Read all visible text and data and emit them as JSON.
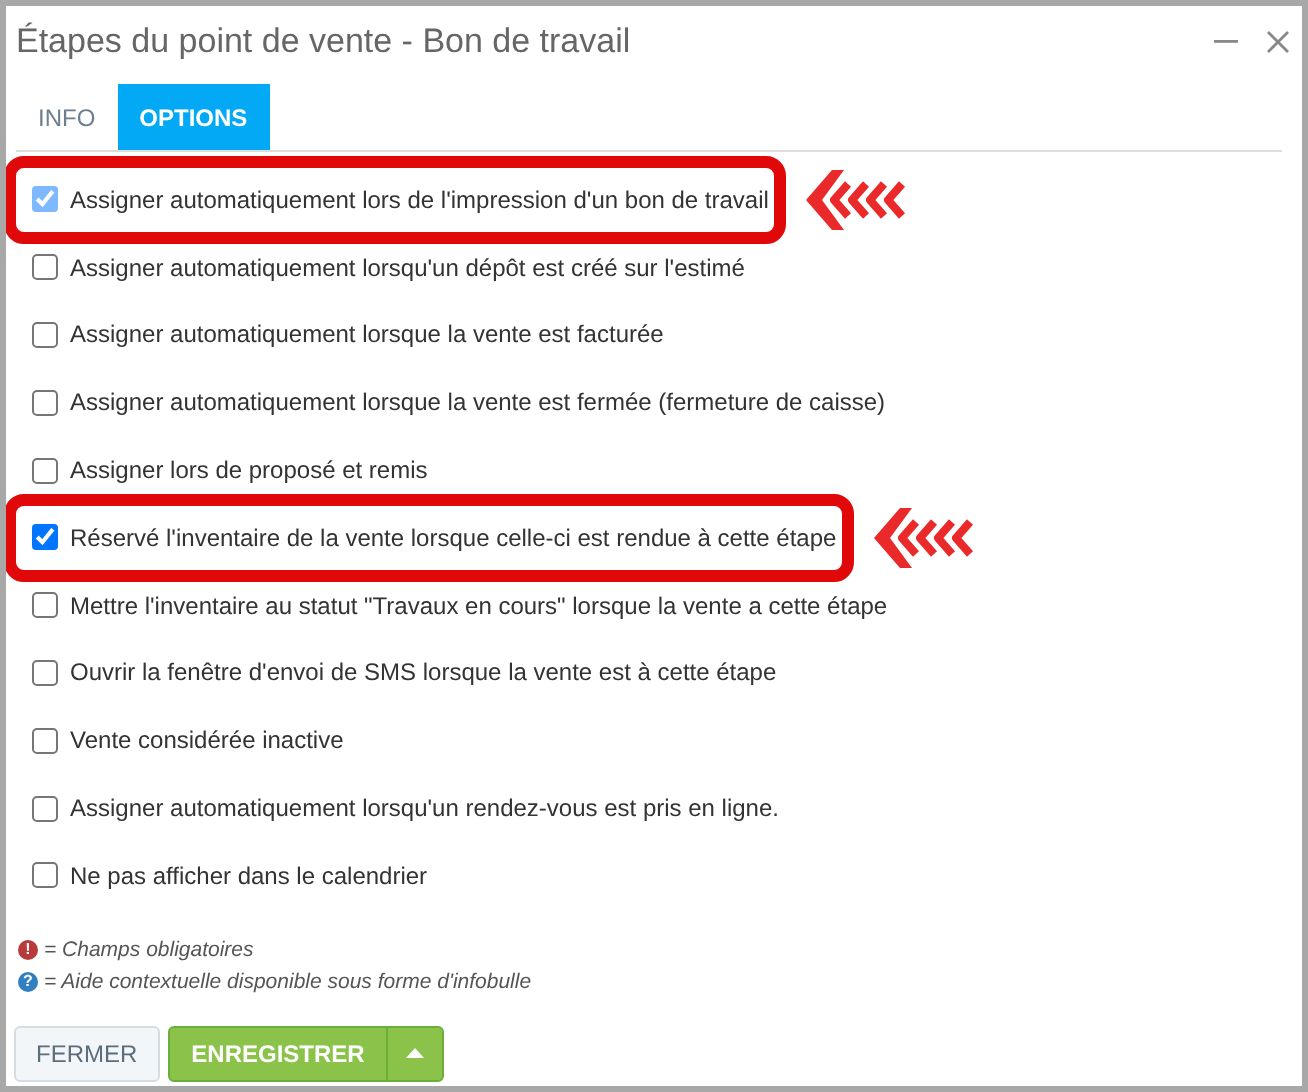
{
  "window": {
    "title": "Étapes du point de vente - Bon de travail"
  },
  "tabs": [
    {
      "label": "INFO",
      "selected": false
    },
    {
      "label": "OPTIONS",
      "selected": true
    }
  ],
  "options": [
    {
      "label": "Assigner automatiquement lors de l'impression d'un bon de travail",
      "checked": true,
      "disabled": true,
      "highlighted": true
    },
    {
      "label": "Assigner automatiquement lorsqu'un dépôt est créé sur l'estimé",
      "checked": false,
      "disabled": false,
      "highlighted": false
    },
    {
      "label": "Assigner automatiquement lorsque la vente est facturée",
      "checked": false,
      "disabled": false,
      "highlighted": false
    },
    {
      "label": "Assigner automatiquement lorsque la vente est fermée (fermeture de caisse)",
      "checked": false,
      "disabled": false,
      "highlighted": false
    },
    {
      "label": "Assigner lors de proposé et remis",
      "checked": false,
      "disabled": false,
      "highlighted": false
    },
    {
      "label": "Réservé l'inventaire de la vente lorsque celle-ci est rendue à cette étape",
      "checked": true,
      "disabled": false,
      "highlighted": true
    },
    {
      "label": "Mettre l'inventaire au statut \"Travaux en cours\" lorsque la vente a cette étape",
      "checked": false,
      "disabled": false,
      "highlighted": false
    },
    {
      "label": "Ouvrir la fenêtre d'envoi de SMS lorsque la vente est à cette étape",
      "checked": false,
      "disabled": false,
      "highlighted": false
    },
    {
      "label": "Vente considérée inactive",
      "checked": false,
      "disabled": false,
      "highlighted": false
    },
    {
      "label": "Assigner automatiquement lorsqu'un rendez-vous est pris en ligne.",
      "checked": false,
      "disabled": false,
      "highlighted": false
    },
    {
      "label": "Ne pas afficher dans le calendrier",
      "checked": false,
      "disabled": false,
      "highlighted": false
    }
  ],
  "legend": [
    {
      "icon": "!",
      "color": "#b83a3a",
      "text": "= Champs obligatoires"
    },
    {
      "icon": "?",
      "color": "#2f7fc1",
      "text": "= Aide contextuelle disponible sous forme d'infobulle"
    }
  ],
  "buttons": {
    "close": "FERMER",
    "save": "ENREGISTRER"
  }
}
